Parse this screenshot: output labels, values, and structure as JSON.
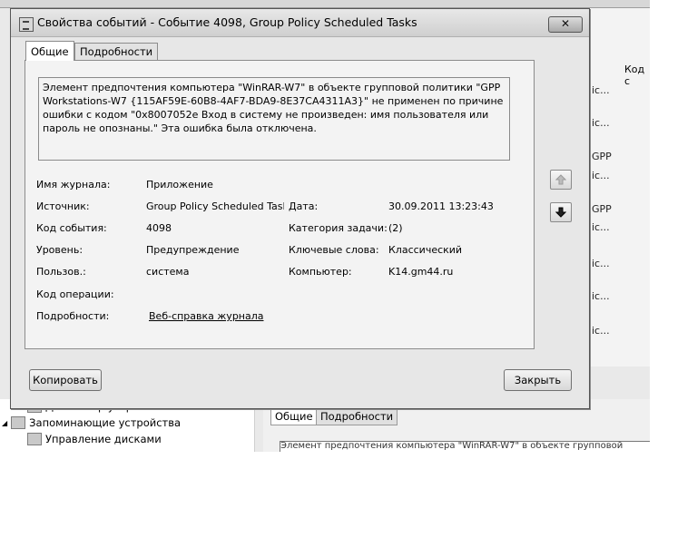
{
  "background": {
    "column_header": "Код с",
    "row_fragments": [
      "ic...",
      "ic...",
      "GPP",
      "ic...",
      "GPP",
      "ic...",
      "ic...",
      "ic...",
      "ic..."
    ],
    "tree": [
      {
        "label": "Диспетчер устройств"
      },
      {
        "label": "Запоминающие устройства"
      },
      {
        "label": "Управление дисками"
      }
    ],
    "tabs": [
      "Общие",
      "Подробности"
    ],
    "partial_message": "Элемент предпочтения компьютера \"WinRAR-W7\" в объекте групповой политики"
  },
  "dialog": {
    "title": "Свойства событий - Событие 4098, Group Policy Scheduled Tasks",
    "close_glyph": "✕",
    "tabs": {
      "general": "Общие",
      "details": "Подробности"
    },
    "message": "Элемент предпочтения компьютера \"WinRAR-W7\" в объекте групповой политики \"GPP Workstations-W7 {115AF59E-60B8-4AF7-BDA9-8E37CA4311A3}\" не применен по причине ошибки с кодом \"0x8007052e Вход в систему не произведен: имя пользователя или пароль не опознаны.\" Эта ошибка была отключена.",
    "fields": {
      "log_name_label": "Имя журнала:",
      "log_name_value": "Приложение",
      "source_label": "Источник:",
      "source_value": "Group Policy Scheduled Tasl",
      "date_label": "Дата:",
      "date_value": "30.09.2011 13:23:43",
      "event_id_label": "Код события:",
      "event_id_value": "4098",
      "task_category_label": "Категория задачи:",
      "task_category_value": "(2)",
      "level_label": "Уровень:",
      "level_value": "Предупреждение",
      "keywords_label": "Ключевые слова:",
      "keywords_value": "Классический",
      "user_label": "Пользов.:",
      "user_value": "система",
      "computer_label": "Компьютер:",
      "computer_value": "K14.gm44.ru",
      "opcode_label": "Код операции:",
      "opcode_value": "",
      "details_label": "Подробности:",
      "details_link": "Веб-справка журнала"
    },
    "buttons": {
      "copy": "Копировать",
      "close": "Закрыть"
    },
    "icons": {
      "up": "arrow-up-icon",
      "down": "arrow-down-icon"
    }
  }
}
